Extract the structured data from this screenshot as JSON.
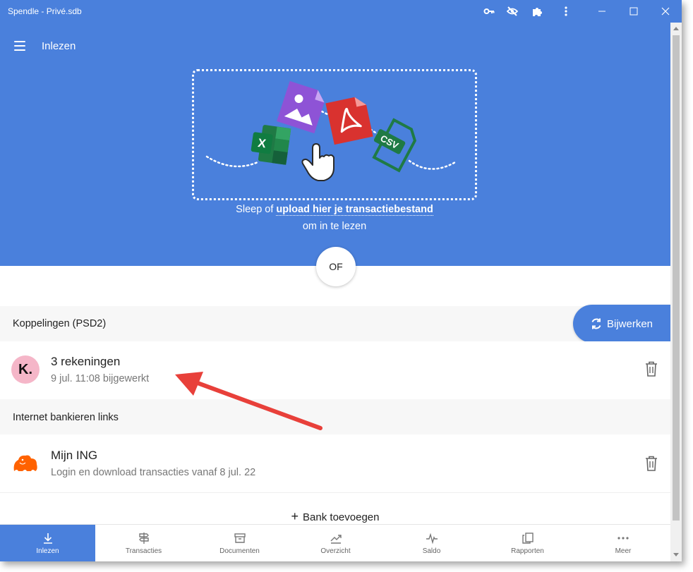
{
  "window": {
    "title": "Spendle - Privé.sdb"
  },
  "header": {
    "title": "Inlezen"
  },
  "upload": {
    "prefix": "Sleep of ",
    "link": "upload hier je transactiebestand",
    "line2": "om in te lezen",
    "csv_label": "CSV",
    "xls_label": "X"
  },
  "or_label": "OF",
  "koppelingen": {
    "label": "Koppelingen (PSD2)",
    "refresh_label": "Bijwerken",
    "item": {
      "logo_text": "K.",
      "title": "3 rekeningen",
      "subtitle": "9 jul. 11:08 bijgewerkt"
    }
  },
  "internet_banking": {
    "label": "Internet bankieren links",
    "item": {
      "title": "Mijn ING",
      "subtitle": "Login en download transacties vanaf 8 jul. 22"
    }
  },
  "add_bank": {
    "label": "Bank toevoegen"
  },
  "nav": [
    {
      "label": "Inlezen",
      "icon": "download-icon"
    },
    {
      "label": "Transacties",
      "icon": "signpost-icon"
    },
    {
      "label": "Documenten",
      "icon": "archive-icon"
    },
    {
      "label": "Overzicht",
      "icon": "trend-icon"
    },
    {
      "label": "Saldo",
      "icon": "pulse-icon"
    },
    {
      "label": "Rapporten",
      "icon": "copy-icon"
    },
    {
      "label": "Meer",
      "icon": "more-icon"
    }
  ],
  "colors": {
    "accent": "#4a80dc",
    "arrow": "#e8403a",
    "klarna": "#f5b6c8",
    "ing": "#ff6200"
  }
}
